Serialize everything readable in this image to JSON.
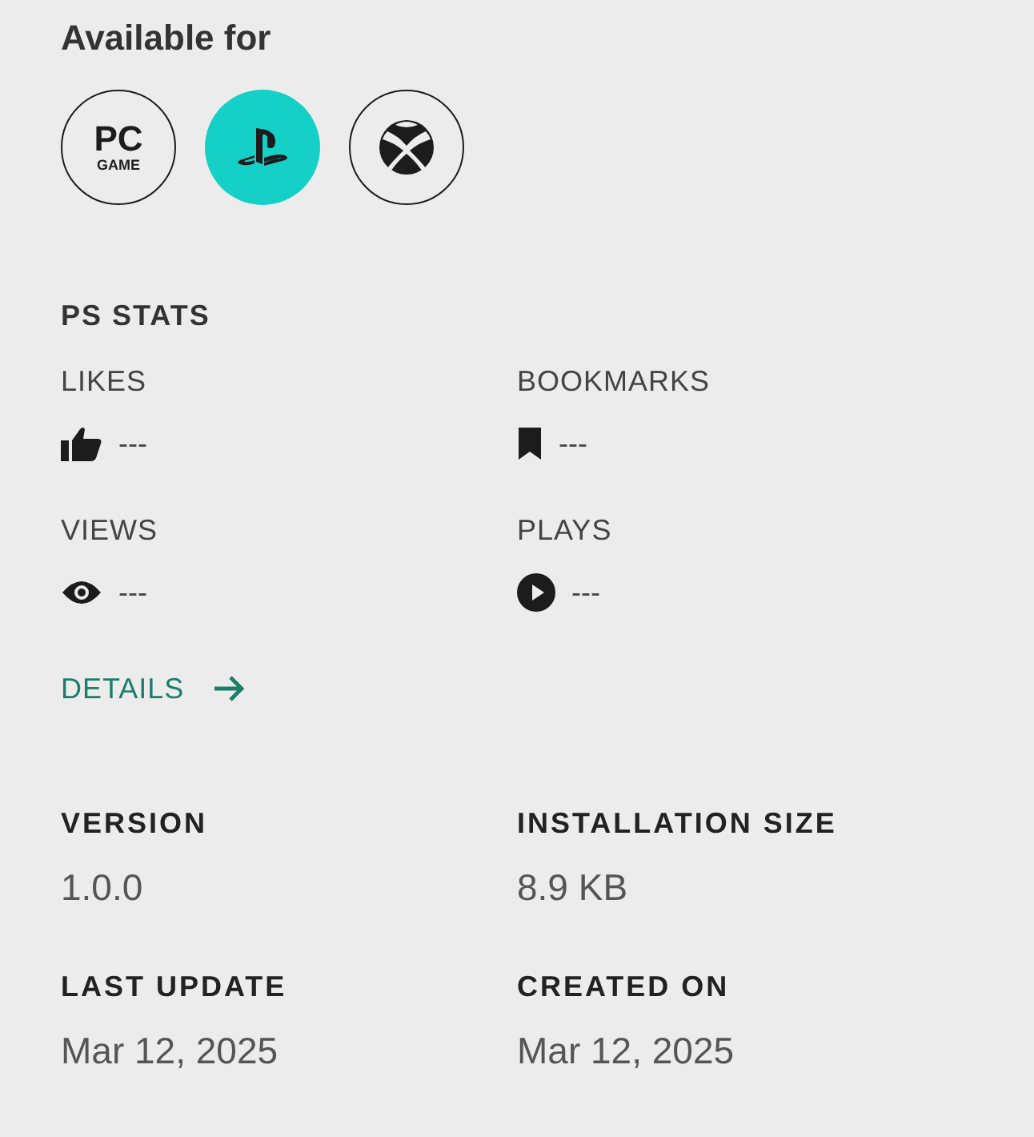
{
  "availability": {
    "title": "Available for",
    "platforms": [
      {
        "kind": "pc",
        "line_1": "PC",
        "line_2": "GAME",
        "selected": false
      },
      {
        "kind": "playstation",
        "selected": true
      },
      {
        "kind": "xbox",
        "selected": false
      }
    ]
  },
  "stats": {
    "title": "PS STATS",
    "items": [
      {
        "kind": "likes",
        "label": "LIKES",
        "value": "---"
      },
      {
        "kind": "bookmarks",
        "label": "BOOKMARKS",
        "value": "---"
      },
      {
        "kind": "views",
        "label": "VIEWS",
        "value": "---"
      },
      {
        "kind": "plays",
        "label": "PLAYS",
        "value": "---"
      }
    ],
    "details_link": "DETAILS"
  },
  "info": [
    {
      "label": "VERSION",
      "value": "1.0.0"
    },
    {
      "label": "INSTALLATION SIZE",
      "value": "8.9 KB"
    },
    {
      "label": "LAST UPDATE",
      "value": "Mar 12, 2025"
    },
    {
      "label": "CREATED ON",
      "value": "Mar 12, 2025"
    }
  ]
}
